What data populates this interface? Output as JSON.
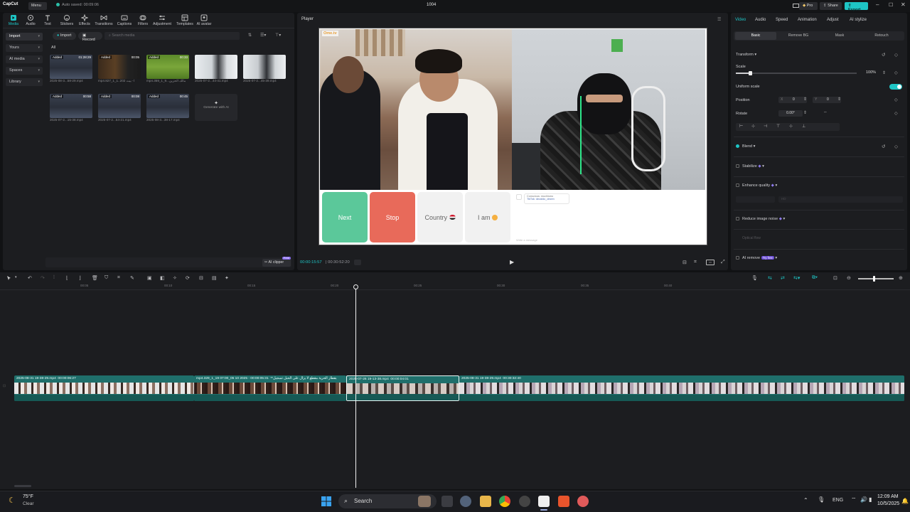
{
  "titlebar": {
    "logo": "CapCut",
    "menu": "Menu",
    "autosave": "Auto saved: 00:09:06",
    "title": "1004",
    "pro": "Pro",
    "share": "Share",
    "export": "Export"
  },
  "toolbar_tabs": [
    {
      "label": "Media",
      "icon": "media-icon"
    },
    {
      "label": "Audio",
      "icon": "audio-icon"
    },
    {
      "label": "Text",
      "icon": "text-icon"
    },
    {
      "label": "Stickers",
      "icon": "stickers-icon"
    },
    {
      "label": "Effects",
      "icon": "effects-icon"
    },
    {
      "label": "Transitions",
      "icon": "transitions-icon"
    },
    {
      "label": "Captions",
      "icon": "captions-icon"
    },
    {
      "label": "Filters",
      "icon": "filters-icon"
    },
    {
      "label": "Adjustment",
      "icon": "adjustment-icon"
    },
    {
      "label": "Templates",
      "icon": "templates-icon"
    },
    {
      "label": "AI avatar",
      "icon": "ai-avatar-icon"
    }
  ],
  "media": {
    "sidebar": [
      "Import",
      "Yours",
      "AI media",
      "Spaces",
      "Library"
    ],
    "import_btn": "Import",
    "record_btn": "Record",
    "search_placeholder": "Search media",
    "filter_all": "All",
    "ai_clipper": "AI clipper",
    "ai_clipper_badge": "Free",
    "generate_ai": "Generate with AI",
    "items": [
      {
        "tag": "Added",
        "duration": "01:28:29",
        "name": "2025-08-3...58-29.mp4"
      },
      {
        "tag": "Added",
        "duration": "00:05",
        "name": "mp4.827_1_1..202 ا- بيت"
      },
      {
        "tag": "Added",
        "duration": "00:33",
        "name": "mp4.359_1_9...مالك الحزين"
      },
      {
        "tag": "",
        "duration": "",
        "name": "2025-07-2...44-41.mp4"
      },
      {
        "tag": "",
        "duration": "",
        "name": "2025-07-2...45-39.mp4"
      },
      {
        "tag": "Added",
        "duration": "00:58",
        "name": "2025-07-2...15-38.mp4"
      },
      {
        "tag": "Added",
        "duration": "00:08",
        "name": "2025-07-2...54-21.mp4"
      },
      {
        "tag": "Added",
        "duration": "00:45",
        "name": "2025-08-3...38-17.mp4"
      }
    ]
  },
  "player": {
    "title": "Player",
    "watermark": "Ome.tv",
    "btn_next": "Next",
    "btn_stop": "Stop",
    "btn_country": "Country",
    "btn_iam": "I am",
    "chat_name": "Conscious: muchismo",
    "chat_sub": "TikTok: dezaldo_dezen",
    "chat_placeholder": "Write a message",
    "time_current": "00:00:15:57",
    "time_total": "00:30:52:20"
  },
  "inspector": {
    "tabs": [
      "Video",
      "Audio",
      "Speed",
      "Animation",
      "Adjust",
      "AI stylize"
    ],
    "subtabs": [
      "Basic",
      "Remove BG",
      "Mask",
      "Retouch"
    ],
    "transform": "Transform",
    "scale": "Scale",
    "scale_value": "100%",
    "scale_fraction": 0.12,
    "uniform_scale": "Uniform scale",
    "position": "Position",
    "pos_x_label": "X",
    "pos_x": "0",
    "pos_y_label": "Y",
    "pos_y": "0",
    "rotate": "Rotate",
    "rotate_value": "0.00°",
    "blend": "Blend",
    "stabilize": "Stabilize",
    "enhance_quality": "Enhance quality",
    "enhance_mode": "HD",
    "reduce_noise": "Reduce image noise",
    "optical_flow": "Optical flow",
    "ai_remove": "AI remove",
    "try_free": "Try free"
  },
  "timeline": {
    "ruler": [
      "00:05",
      "00:10",
      "00:15",
      "00:20",
      "00:25",
      "00:30",
      "00:35",
      "00:40"
    ],
    "clips": [
      {
        "name": "2025-08-31 19-38-29.mp4",
        "duration": "00:00:06:27"
      },
      {
        "name": "mp4.329_1_19 07:00_05 10 2025 - بقطار الحرية مقطع لا يزال على الحبل تسجيل**",
        "duration": "00:00:05:31"
      },
      {
        "name": "2025-07-26 19-13-38.mp4",
        "duration": "00:00:04:01"
      },
      {
        "name": "2025-08-31 19-38-29.mp4",
        "duration": "00:30:32:40"
      }
    ]
  },
  "taskbar": {
    "weather_temp": "75°F",
    "weather_desc": "Clear",
    "search": "Search",
    "lang": "ENG",
    "time": "12:09 AM",
    "date": "10/5/2025"
  },
  "colors": {
    "accent": "#1ec5c5",
    "next_green": "#5bc89a",
    "stop_red": "#e86a5a",
    "clip_teal": "#1f6f6b"
  }
}
